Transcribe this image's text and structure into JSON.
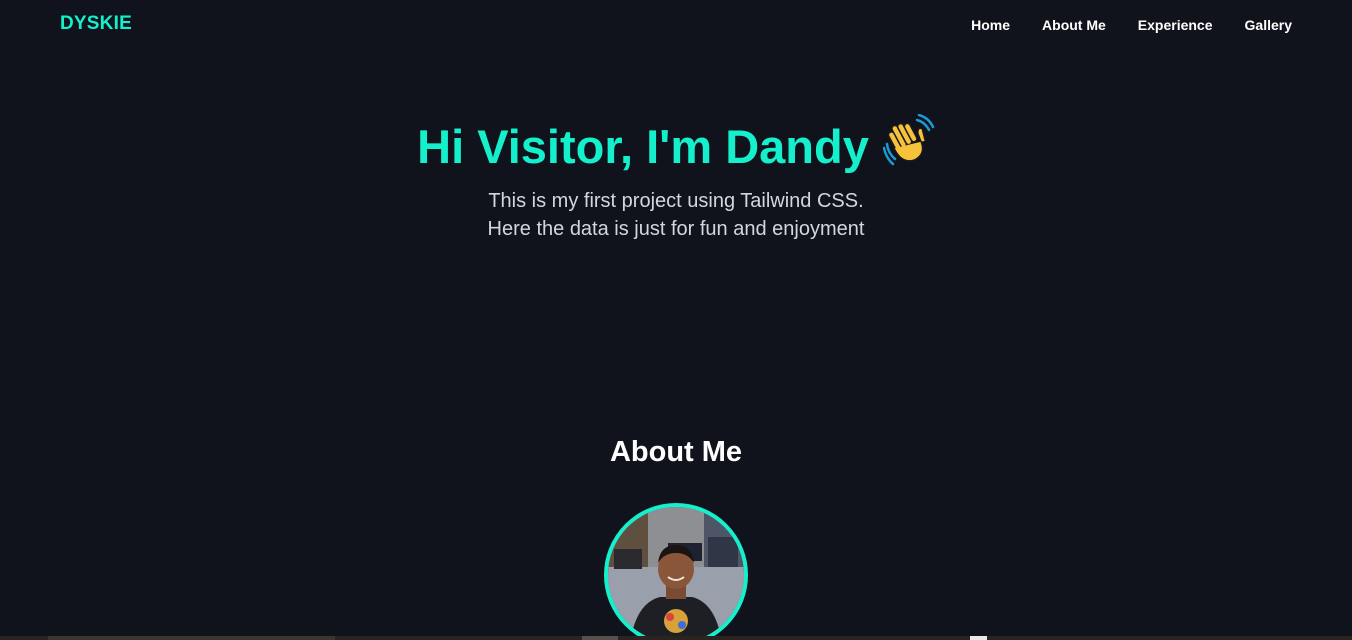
{
  "navbar": {
    "brand": "DYSKIE",
    "links": [
      "Home",
      "About Me",
      "Experience",
      "Gallery"
    ]
  },
  "hero": {
    "title": "Hi Visitor, I'm Dandy",
    "subtitle_line1": "This is my first project using Tailwind CSS.",
    "subtitle_line2": "Here the data is just for fun and enjoyment",
    "emoji_icon": "waving-hand-icon"
  },
  "about": {
    "heading": "About Me"
  },
  "colors": {
    "background": "#11131c",
    "accent": "#14f0cc",
    "text": "#ffffff",
    "subtext": "#d4d6dc"
  }
}
